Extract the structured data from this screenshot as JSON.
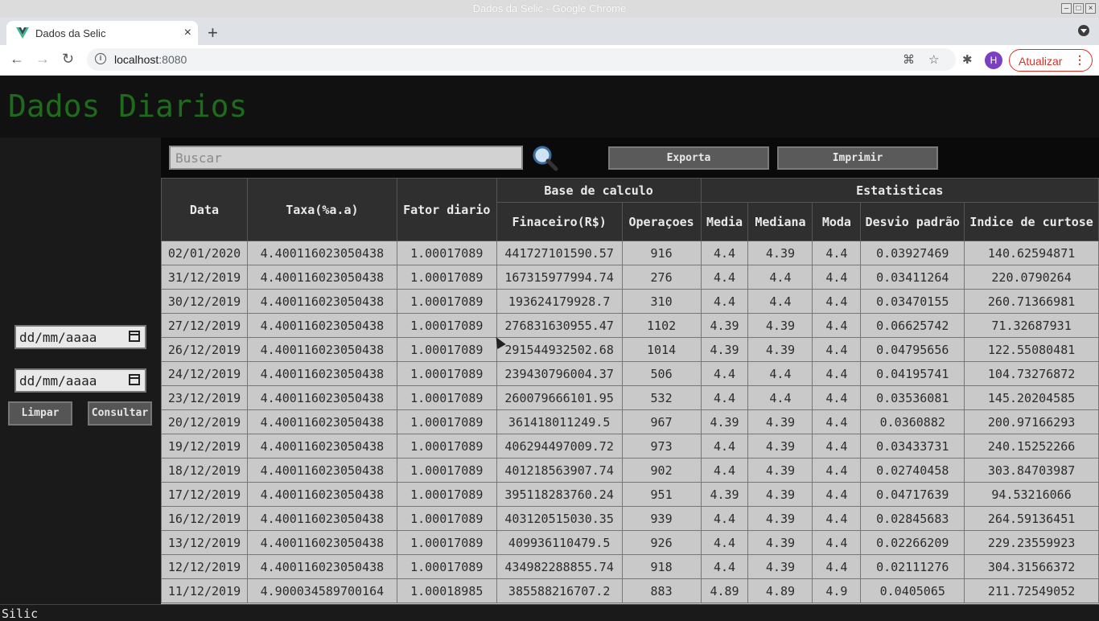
{
  "window": {
    "title": "Dados da Selic - Google Chrome"
  },
  "tab": {
    "title": "Dados da Selic",
    "close": "×",
    "new_tab": "+"
  },
  "toolbar": {
    "url_host": "localhost",
    "url_port": ":8080",
    "avatar_letter": "H",
    "update_label": "Atualizar"
  },
  "page": {
    "heading": "Dados Diarios",
    "search_placeholder": "Buscar",
    "export_label": "Exporta",
    "print_label": "Imprimir",
    "date_from": "dd/mm/aaaa",
    "date_to": "dd/mm/aaaa",
    "clear_label": "Limpar",
    "query_label": "Consultar",
    "footer": "Silic"
  },
  "table": {
    "h_data": "Data",
    "h_taxa": "Taxa(%a.a)",
    "h_fator": "Fator diario",
    "h_base": "Base de calculo",
    "h_estat": "Estatisticas",
    "h_fin": "Finaceiro(R$)",
    "h_ops": "Operaçoes",
    "h_media": "Media",
    "h_mediana": "Mediana",
    "h_moda": "Moda",
    "h_desvio": "Desvio padrão",
    "h_curtose": "Indice de curtose",
    "rows": [
      [
        "02/01/2020",
        "4.400116023050438",
        "1.00017089",
        "441727101590.57",
        "916",
        "4.4",
        "4.39",
        "4.4",
        "0.03927469",
        "140.62594871"
      ],
      [
        "31/12/2019",
        "4.400116023050438",
        "1.00017089",
        "167315977994.74",
        "276",
        "4.4",
        "4.4",
        "4.4",
        "0.03411264",
        "220.0790264"
      ],
      [
        "30/12/2019",
        "4.400116023050438",
        "1.00017089",
        "193624179928.7",
        "310",
        "4.4",
        "4.4",
        "4.4",
        "0.03470155",
        "260.71366981"
      ],
      [
        "27/12/2019",
        "4.400116023050438",
        "1.00017089",
        "276831630955.47",
        "1102",
        "4.39",
        "4.39",
        "4.4",
        "0.06625742",
        "71.32687931"
      ],
      [
        "26/12/2019",
        "4.400116023050438",
        "1.00017089",
        "291544932502.68",
        "1014",
        "4.39",
        "4.39",
        "4.4",
        "0.04795656",
        "122.55080481"
      ],
      [
        "24/12/2019",
        "4.400116023050438",
        "1.00017089",
        "239430796004.37",
        "506",
        "4.4",
        "4.4",
        "4.4",
        "0.04195741",
        "104.73276872"
      ],
      [
        "23/12/2019",
        "4.400116023050438",
        "1.00017089",
        "260079666101.95",
        "532",
        "4.4",
        "4.4",
        "4.4",
        "0.03536081",
        "145.20204585"
      ],
      [
        "20/12/2019",
        "4.400116023050438",
        "1.00017089",
        "361418011249.5",
        "967",
        "4.39",
        "4.39",
        "4.4",
        "0.0360882",
        "200.97166293"
      ],
      [
        "19/12/2019",
        "4.400116023050438",
        "1.00017089",
        "406294497009.72",
        "973",
        "4.4",
        "4.39",
        "4.4",
        "0.03433731",
        "240.15252266"
      ],
      [
        "18/12/2019",
        "4.400116023050438",
        "1.00017089",
        "401218563907.74",
        "902",
        "4.4",
        "4.39",
        "4.4",
        "0.02740458",
        "303.84703987"
      ],
      [
        "17/12/2019",
        "4.400116023050438",
        "1.00017089",
        "395118283760.24",
        "951",
        "4.39",
        "4.39",
        "4.4",
        "0.04717639",
        "94.53216066"
      ],
      [
        "16/12/2019",
        "4.400116023050438",
        "1.00017089",
        "403120515030.35",
        "939",
        "4.4",
        "4.39",
        "4.4",
        "0.02845683",
        "264.59136451"
      ],
      [
        "13/12/2019",
        "4.400116023050438",
        "1.00017089",
        "409936110479.5",
        "926",
        "4.4",
        "4.39",
        "4.4",
        "0.02266209",
        "229.23559923"
      ],
      [
        "12/12/2019",
        "4.400116023050438",
        "1.00017089",
        "434982288855.74",
        "918",
        "4.4",
        "4.39",
        "4.4",
        "0.02111276",
        "304.31566372"
      ],
      [
        "11/12/2019",
        "4.900034589700164",
        "1.00018985",
        "385588216707.2",
        "883",
        "4.89",
        "4.89",
        "4.9",
        "0.0405065",
        "211.72549052"
      ]
    ]
  }
}
